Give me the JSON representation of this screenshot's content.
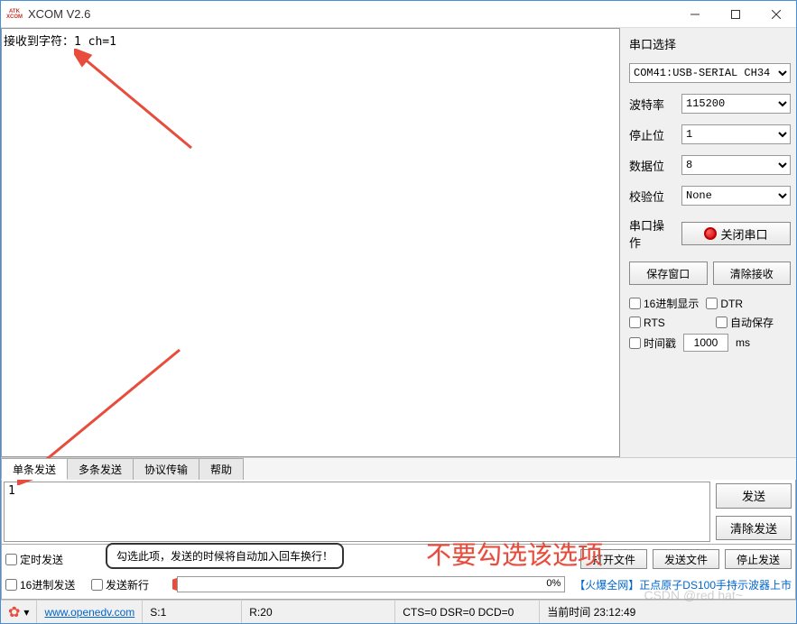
{
  "titlebar": {
    "title": "XCOM V2.6",
    "logo_top": "ATK",
    "logo_bot": "XCOM"
  },
  "rx": {
    "text": "接收到字符：1 ch=1"
  },
  "serial": {
    "section_title": "串口选择",
    "port": "COM41:USB-SERIAL CH34",
    "baud_label": "波特率",
    "baud_value": "115200",
    "stop_label": "停止位",
    "stop_value": "1",
    "data_label": "数据位",
    "data_value": "8",
    "parity_label": "校验位",
    "parity_value": "None",
    "op_label": "串口操作",
    "op_btn": "关闭串口",
    "save_btn": "保存窗口",
    "clear_rx_btn": "清除接收",
    "hex_disp": "16进制显示",
    "dtr": "DTR",
    "rts": "RTS",
    "autosave": "自动保存",
    "timestamp": "时间戳",
    "ts_value": "1000",
    "ts_unit": "ms"
  },
  "tabs": {
    "single": "单条发送",
    "multi": "多条发送",
    "proto": "协议传输",
    "help": "帮助"
  },
  "tx": {
    "input": "1",
    "send_btn": "发送",
    "clear_btn": "清除发送",
    "timed_send": "定时发送",
    "hex_send": "16进制发送",
    "send_newline": "发送新行",
    "open_file_btn": "打开文件",
    "send_file_btn": "发送文件",
    "stop_btn": "停止发送",
    "progress_pct": "0%",
    "tooltip": "勾选此项，发送的时候将自动加入回车换行！",
    "promo_prefix": "【火爆全网】",
    "promo_text": "正点原子DS100手持示波器上市"
  },
  "overlay": {
    "red_note": "不要勾选该选项"
  },
  "status": {
    "url": "www.openedv.com",
    "s": "S:1",
    "r": "R:20",
    "cts": "CTS=0 DSR=0 DCD=0",
    "time_label": "当前时间",
    "time_value": "23:12:49"
  },
  "watermark": "CSDN @red hat~"
}
